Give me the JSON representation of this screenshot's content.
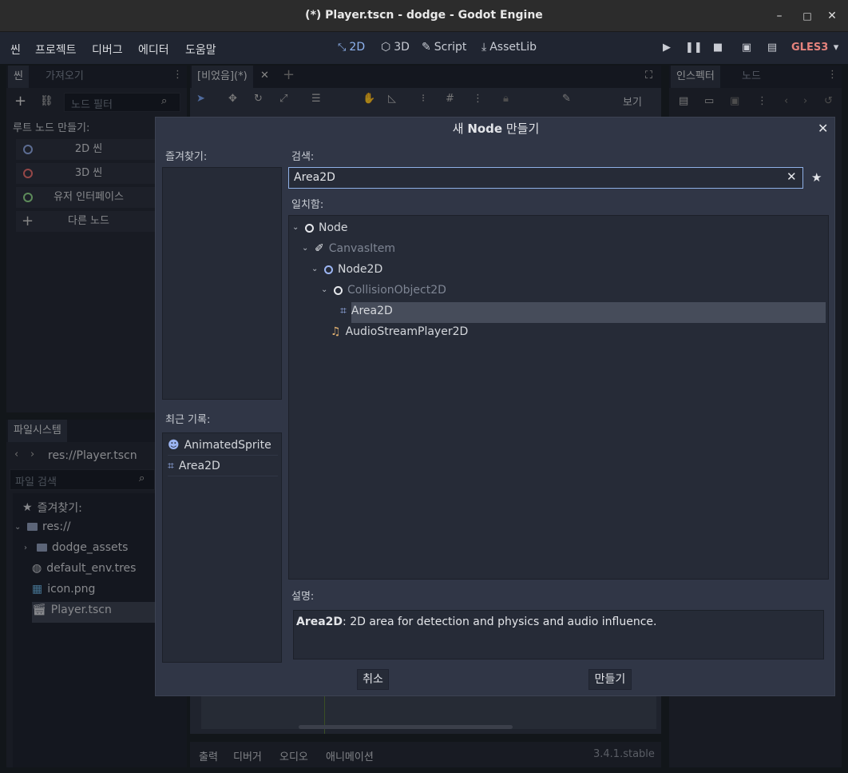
{
  "window": {
    "title": "(*) Player.tscn - dodge - Godot Engine",
    "min": "–",
    "max": "□",
    "close": "✕"
  },
  "menu": [
    "씬",
    "프로젝트",
    "디버그",
    "에디터",
    "도움말"
  ],
  "workspaces": [
    {
      "label": "2D",
      "icon": "2d-icon",
      "active": true
    },
    {
      "label": "3D",
      "icon": "3d-icon",
      "active": false
    },
    {
      "label": "Script",
      "icon": "script-icon",
      "active": false
    },
    {
      "label": "AssetLib",
      "icon": "assetlib-icon",
      "active": false
    }
  ],
  "renderer": "GLES3",
  "scene_dock": {
    "tabs": [
      "씬",
      "가져오기"
    ],
    "filter_placeholder": "노드 필터",
    "root_label": "루트 노드 만들기:",
    "buttons": [
      "2D 씬",
      "3D 씬",
      "유저 인터페이스",
      "다른 노드"
    ],
    "button_colors": [
      "#8ea6e0",
      "#e36d6d",
      "#8fd68a",
      "#cccccc"
    ]
  },
  "filesystem": {
    "tab": "파일시스템",
    "path": "res://Player.tscn",
    "search_placeholder": "파일 검색",
    "favorites": "즐겨찾기:",
    "root": "res://",
    "items": [
      "dodge_assets",
      "default_env.tres",
      "icon.png",
      "Player.tscn"
    ]
  },
  "editor": {
    "tab": "[비었음](*)",
    "view_label": "보기"
  },
  "inspector": {
    "tabs": [
      "인스펙터",
      "노드"
    ]
  },
  "dialog": {
    "title_prefix": "새 ",
    "title_bold": "Node",
    "title_suffix": " 만들기",
    "favorites_label": "즐겨찾기:",
    "recent_label": "최근 기록:",
    "recent": [
      "AnimatedSprite",
      "Area2D"
    ],
    "search_label": "검색:",
    "search_value": "Area2D",
    "matches_label": "일치함:",
    "tree": [
      "Node",
      "CanvasItem",
      "Node2D",
      "CollisionObject2D",
      "Area2D",
      "AudioStreamPlayer2D"
    ],
    "description_label": "설명:",
    "description_name": "Area2D",
    "description_text": ": 2D area for detection and physics and audio influence.",
    "cancel": "취소",
    "create": "만들기"
  },
  "bottom": {
    "tabs": [
      "출력",
      "디버거",
      "오디오",
      "애니메이션"
    ],
    "version": "3.4.1.stable"
  }
}
